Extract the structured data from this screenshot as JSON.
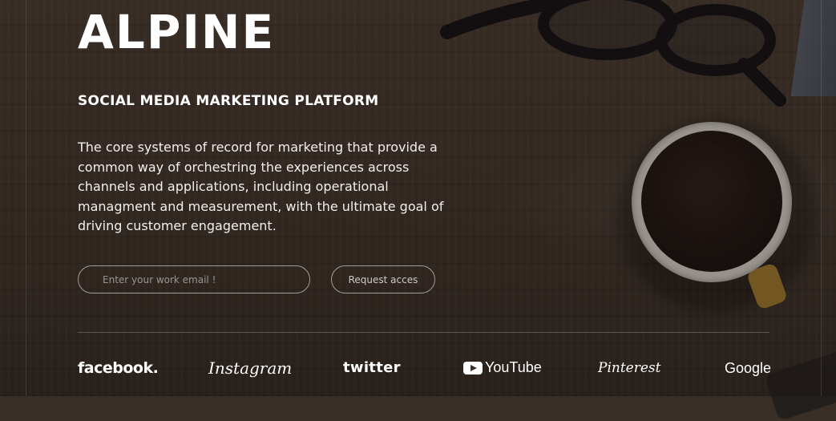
{
  "brand": {
    "logo": "ALPINE"
  },
  "hero": {
    "subtitle": "SOCIAL MEDIA MARKETING PLATFORM",
    "description": "The core systems of record for marketing that provide a common way of orchestring the experiences across channels and applications, including operational managment and measurement, with the ultimate goal of driving customer engagement."
  },
  "signup": {
    "email_placeholder": "Enter your work email !",
    "email_value": "",
    "request_label": "Request acces"
  },
  "partners": {
    "facebook": "facebook.",
    "instagram": "Instagram",
    "twitter": "twitter",
    "youtube": "YouTube",
    "pinterest": "Pinterest",
    "google": "Google"
  },
  "colors": {
    "background": "#3a2f27",
    "text": "#ffffff"
  }
}
